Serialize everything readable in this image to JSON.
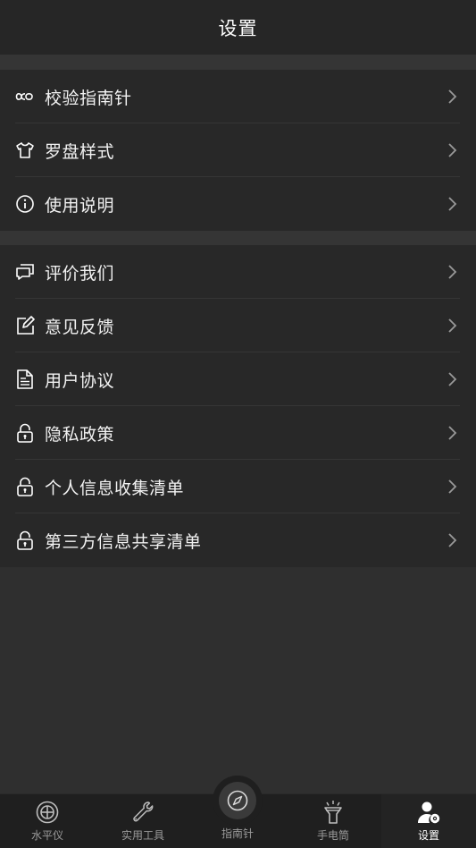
{
  "header": {
    "title": "设置"
  },
  "section1": {
    "items": [
      {
        "label": "校验指南针",
        "icon": "infinity-icon"
      },
      {
        "label": "罗盘样式",
        "icon": "shirt-icon"
      },
      {
        "label": "使用说明",
        "icon": "info-icon"
      }
    ]
  },
  "section2": {
    "items": [
      {
        "label": "评价我们",
        "icon": "chat-icon"
      },
      {
        "label": "意见反馈",
        "icon": "edit-icon"
      },
      {
        "label": "用户协议",
        "icon": "document-icon"
      },
      {
        "label": "隐私政策",
        "icon": "lock-icon"
      },
      {
        "label": "个人信息收集清单",
        "icon": "lock-icon"
      },
      {
        "label": "第三方信息共享清单",
        "icon": "lock-icon"
      }
    ]
  },
  "tabbar": {
    "tabs": [
      {
        "label": "水平仪",
        "icon": "level-icon",
        "active": false
      },
      {
        "label": "实用工具",
        "icon": "wrench-icon",
        "active": false
      },
      {
        "label": "指南针",
        "icon": "compass-icon",
        "active": false
      },
      {
        "label": "手电筒",
        "icon": "flashlight-icon",
        "active": false
      },
      {
        "label": "设置",
        "icon": "user-settings-icon",
        "active": true
      }
    ]
  },
  "colors": {
    "background": "#2f2f2f",
    "header": "#262626",
    "section": "#282828",
    "tabbar": "#1f1f1f",
    "text": "#f2f2f2",
    "inactive_tab": "#9a9a9a"
  }
}
